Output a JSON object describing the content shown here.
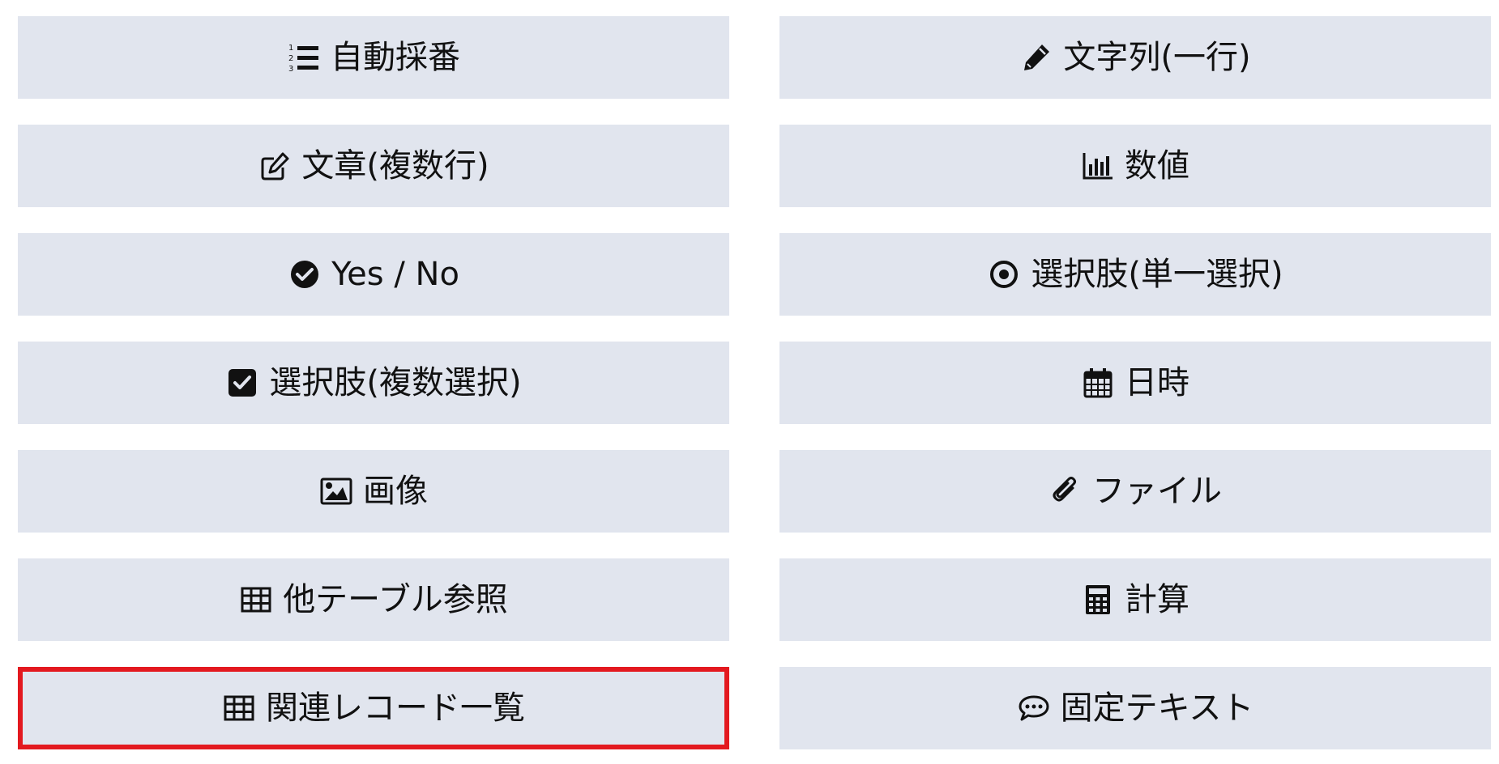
{
  "fields": [
    {
      "label": "自動採番",
      "icon": "list-ol-icon"
    },
    {
      "label": "文字列(一行)",
      "icon": "pencil-icon"
    },
    {
      "label": "文章(複数行)",
      "icon": "edit-icon"
    },
    {
      "label": "数値",
      "icon": "bar-chart-icon"
    },
    {
      "label": "Yes / No",
      "icon": "check-circle-icon"
    },
    {
      "label": "選択肢(単一選択)",
      "icon": "dot-circle-icon"
    },
    {
      "label": "選択肢(複数選択)",
      "icon": "check-square-icon"
    },
    {
      "label": "日時",
      "icon": "calendar-icon"
    },
    {
      "label": "画像",
      "icon": "image-icon"
    },
    {
      "label": "ファイル",
      "icon": "paperclip-icon"
    },
    {
      "label": "他テーブル参照",
      "icon": "table-icon"
    },
    {
      "label": "計算",
      "icon": "calculator-icon"
    },
    {
      "label": "関連レコード一覧",
      "icon": "table-icon",
      "selected": true
    },
    {
      "label": "固定テキスト",
      "icon": "comment-dots-icon"
    }
  ],
  "colors": {
    "button_bg": "#e1e5ee",
    "text": "#111111",
    "selected_border": "#e3191f"
  }
}
